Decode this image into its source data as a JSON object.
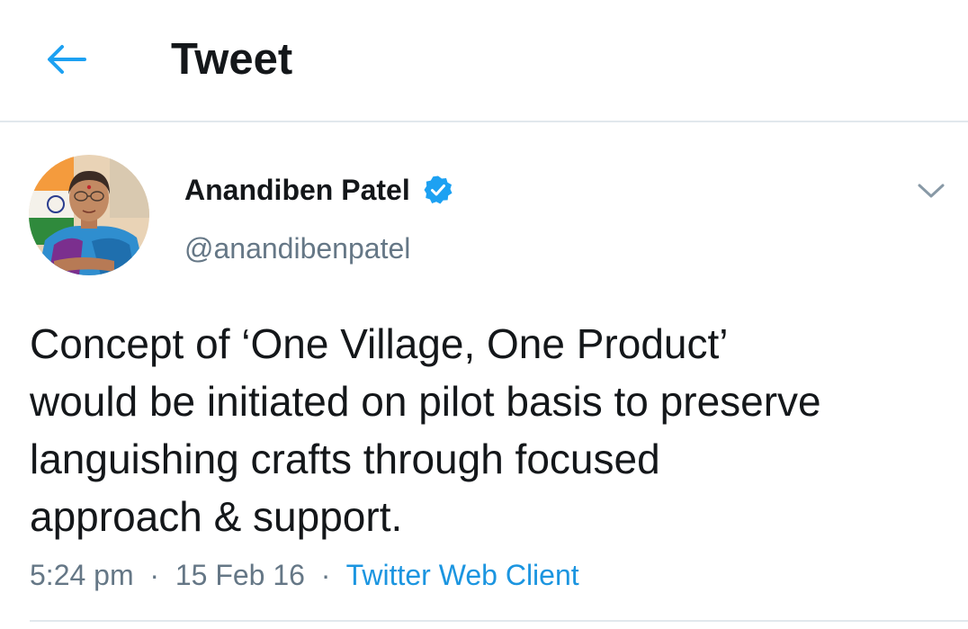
{
  "header": {
    "back_icon": "arrow-left-icon",
    "title": "Tweet"
  },
  "tweet": {
    "author": {
      "name": "Anandiben Patel",
      "handle": "@anandibenpatel",
      "verified": true,
      "verified_icon": "verified-badge-icon"
    },
    "menu_icon": "chevron-down-icon",
    "text_lines": [
      "Concept of ‘One Village, One Product’",
      "would be initiated on pilot basis to preserve",
      "languishing crafts through focused",
      "approach & support."
    ],
    "meta": {
      "time": "5:24 pm",
      "separator": "·",
      "date": "15 Feb 16",
      "source": "Twitter Web Client"
    }
  },
  "colors": {
    "accent": "#1da1f2",
    "link": "#1b95e0",
    "secondary_text": "#657786",
    "divider": "#e1e8ed"
  }
}
